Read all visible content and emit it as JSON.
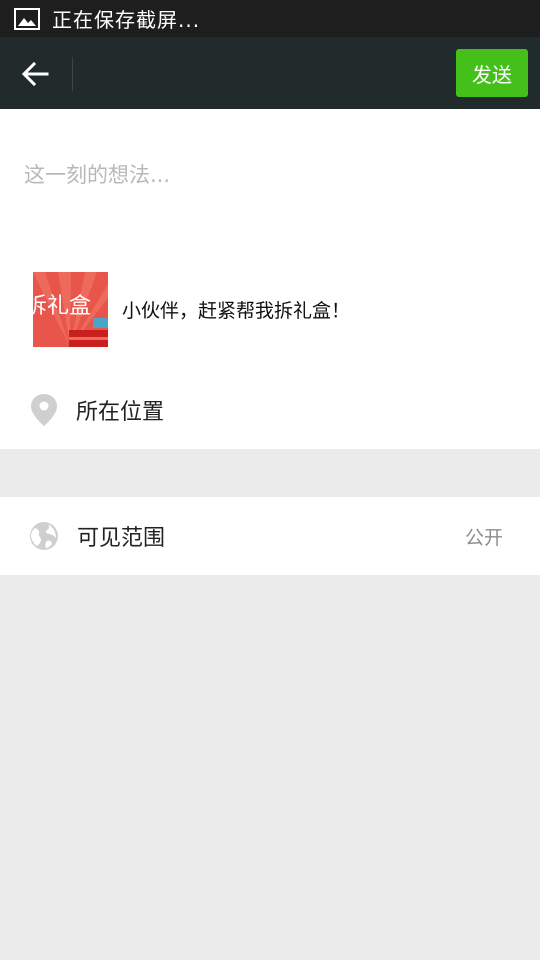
{
  "status_bar": {
    "text": "正在保存截屏..."
  },
  "header": {
    "send_label": "发送"
  },
  "composer": {
    "placeholder": "这一刻的想法...",
    "share_card": {
      "title": "小伙伴，赶紧帮我拆礼盒！",
      "thumbnail_text": "拆礼盒"
    }
  },
  "location": {
    "label": "所在位置"
  },
  "visibility": {
    "label": "可见范围",
    "value": "公开"
  },
  "colors": {
    "send_button": "#45c01a",
    "title_bar": "#212b2b",
    "status_bar": "#1e1e1e",
    "background": "#ebebeb"
  },
  "icons": {
    "status": "image-icon",
    "back": "back-arrow-icon",
    "location": "location-pin-icon",
    "visibility": "globe-icon"
  }
}
